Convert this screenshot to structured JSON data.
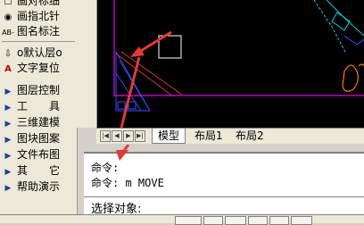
{
  "sidebar": {
    "items": [
      {
        "label": "画对标细",
        "icon": "text-icon"
      },
      {
        "label": "画指北针",
        "icon": "north-arrow-icon"
      },
      {
        "label": "图名标注",
        "icon": "title-annotation-icon",
        "icon_text": "AB-"
      },
      {
        "label": "o默认层o",
        "icon": "layer-arrow-icon"
      },
      {
        "label": "文字复位",
        "icon": "text-reset-icon",
        "icon_text": "A"
      },
      {
        "label": "图层控制",
        "icon": "expand-triangle-icon"
      },
      {
        "label": "工　　具",
        "icon": "expand-triangle-icon"
      },
      {
        "label": "三维建模",
        "icon": "expand-triangle-icon"
      },
      {
        "label": "图块图案",
        "icon": "expand-triangle-icon"
      },
      {
        "label": "文件布图",
        "icon": "expand-triangle-icon"
      },
      {
        "label": "其　　它",
        "icon": "expand-triangle-icon"
      },
      {
        "label": "帮助演示",
        "icon": "expand-triangle-icon"
      }
    ]
  },
  "tabs": {
    "items": [
      {
        "label": "模型",
        "active": true
      },
      {
        "label": "布局1",
        "active": false
      },
      {
        "label": "布局2",
        "active": false
      }
    ]
  },
  "command": {
    "line1": "命令:",
    "line2": "命令: m MOVE",
    "prompt": "选择对象:"
  },
  "colors": {
    "canvas": "#000000",
    "arrow": "#e53935",
    "frame_magenta": "#c000c0",
    "frame_blue": "#3050ff",
    "cyan": "#00d0e0",
    "orange": "#ff7a00"
  }
}
